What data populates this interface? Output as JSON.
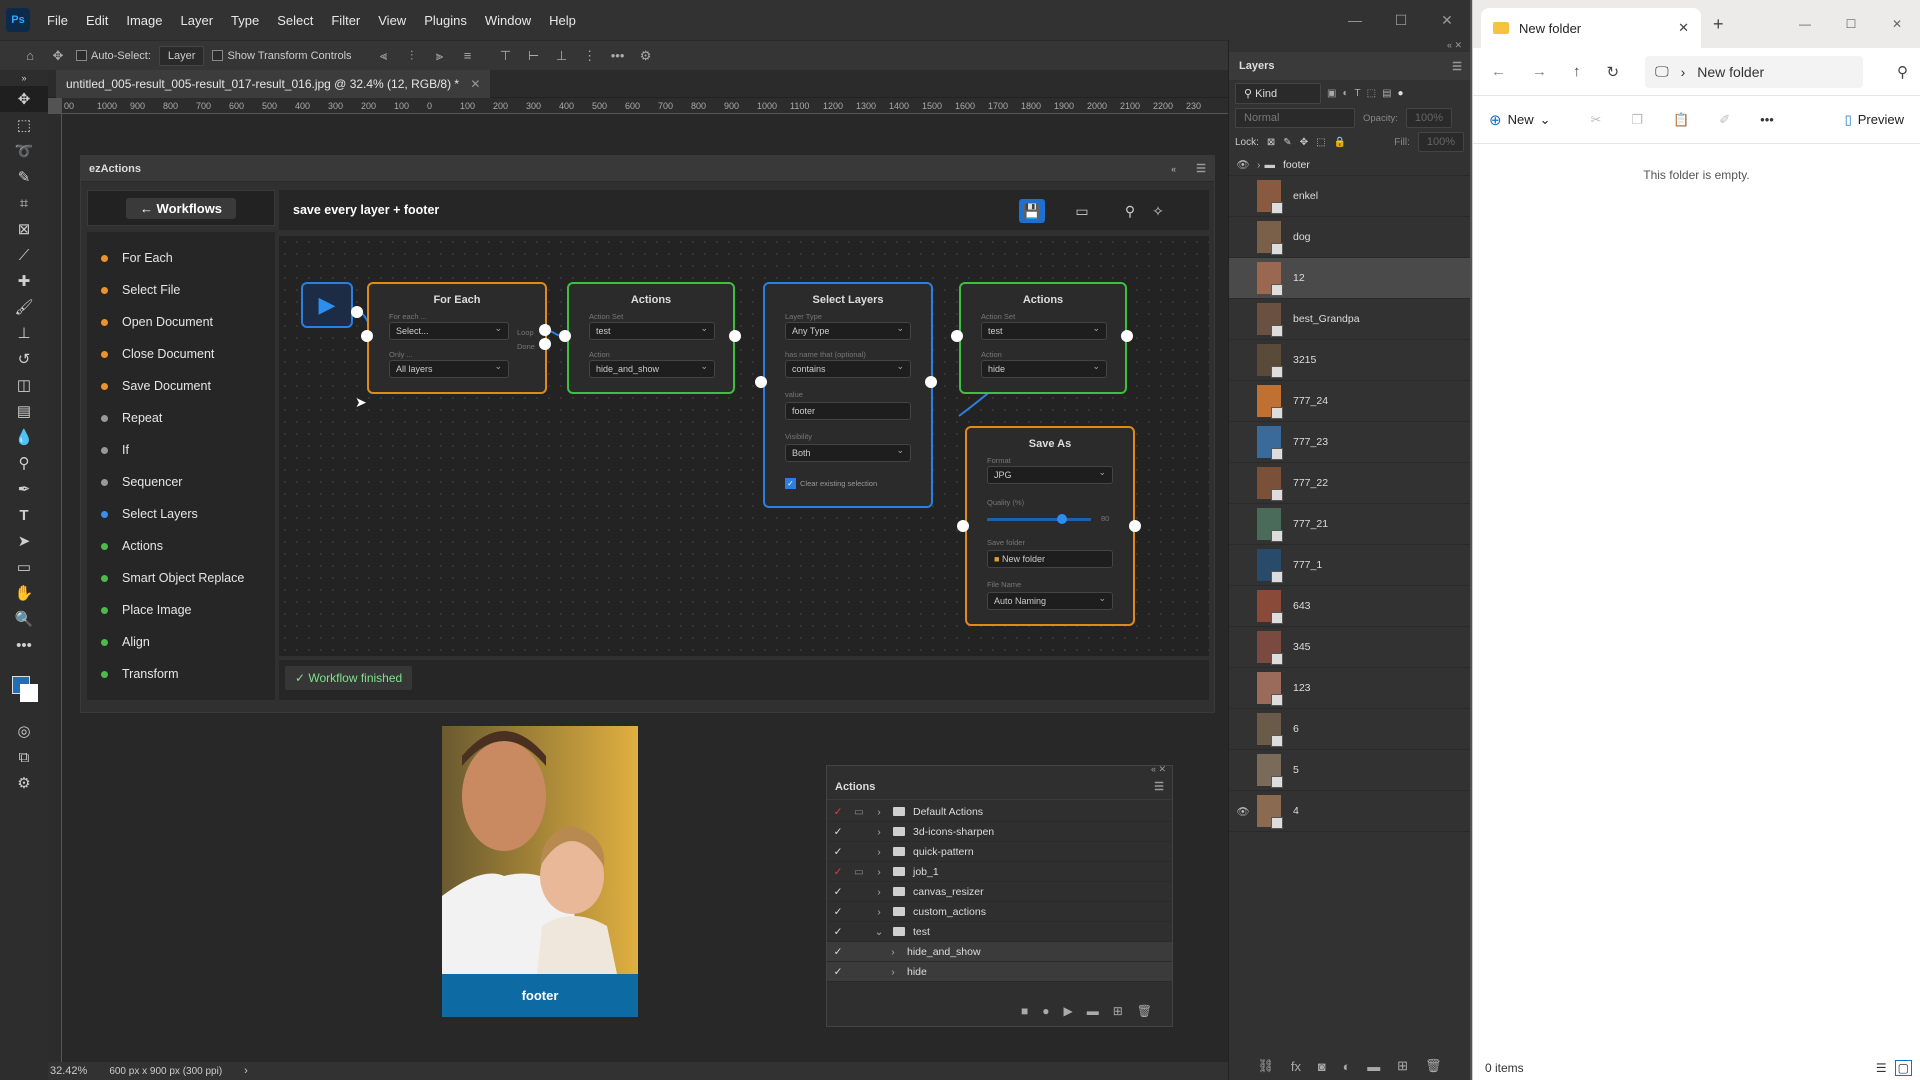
{
  "menu": [
    "File",
    "Edit",
    "Image",
    "Layer",
    "Type",
    "Select",
    "Filter",
    "View",
    "Plugins",
    "Window",
    "Help"
  ],
  "app_logo": "Ps",
  "options": {
    "auto_select": "Auto-Select:",
    "layer": "Layer",
    "transform": "Show Transform Controls"
  },
  "doc_tab": "untitled_005-result_005-result_017-result_016.jpg @ 32.4% (12, RGB/8) *",
  "ruler_ticks": [
    "00",
    "1000",
    "900",
    "800",
    "700",
    "600",
    "500",
    "400",
    "300",
    "200",
    "100",
    "0",
    "100",
    "200",
    "300",
    "400",
    "500",
    "600",
    "700",
    "800",
    "900",
    "1000",
    "1100",
    "1200",
    "1300",
    "1400",
    "1500",
    "1600",
    "1700",
    "1800",
    "1900",
    "2000",
    "2100",
    "2200",
    "230"
  ],
  "status": {
    "zoom": "32.42%",
    "doc": "600 px x 900 px (300 ppi)"
  },
  "ez": {
    "panel_title": "ezActions",
    "workflows_btn": "← Workflows",
    "workflow_title": "save every layer + footer",
    "status": "✓  Workflow finished",
    "list": [
      {
        "label": "For Each",
        "color": "#f0922b"
      },
      {
        "label": "Select File",
        "color": "#f0922b"
      },
      {
        "label": "Open Document",
        "color": "#f0922b"
      },
      {
        "label": "Close Document",
        "color": "#f0922b"
      },
      {
        "label": "Save Document",
        "color": "#f0922b"
      },
      {
        "label": "Repeat",
        "color": "#999999"
      },
      {
        "label": "If",
        "color": "#999999"
      },
      {
        "label": "Sequencer",
        "color": "#999999"
      },
      {
        "label": "Select Layers",
        "color": "#3a8ef0"
      },
      {
        "label": "Actions",
        "color": "#4cbb4c"
      },
      {
        "label": "Smart Object Replace",
        "color": "#4cbb4c"
      },
      {
        "label": "Place Image",
        "color": "#4cbb4c"
      },
      {
        "label": "Align",
        "color": "#4cbb4c"
      },
      {
        "label": "Transform",
        "color": "#4cbb4c"
      }
    ],
    "nodes": {
      "foreach": {
        "title": "For Each",
        "l1": "For each ...",
        "v1": "Select...",
        "l2": "Only ...",
        "v2": "All layers",
        "loop": "Loop",
        "done": "Done"
      },
      "actions1": {
        "title": "Actions",
        "l1": "Action Set",
        "v1": "test",
        "l2": "Action",
        "v2": "hide_and_show"
      },
      "select": {
        "title": "Select Layers",
        "l1": "Layer Type",
        "v1": "Any Type",
        "l2": "has name that (optional)",
        "v2": "contains",
        "l3": "value",
        "v3": "footer",
        "l4": "Visibility",
        "v4": "Both",
        "chk": "Clear existing selection"
      },
      "actions2": {
        "title": "Actions",
        "l1": "Action Set",
        "v1": "test",
        "l2": "Action",
        "v2": "hide"
      },
      "saveas": {
        "title": "Save As",
        "l1": "Format",
        "v1": "JPG",
        "l2": "Quality (%)",
        "v2": "80",
        "l3": "Save folder",
        "v3": "New folder",
        "l4": "File Name",
        "v4": "Auto Naming"
      }
    }
  },
  "thumb_footer": "footer",
  "actions_panel": {
    "title": "Actions",
    "rows": [
      {
        "name": "Default Actions",
        "red": true,
        "dlg": true,
        "open": false,
        "sub": false
      },
      {
        "name": "3d-icons-sharpen",
        "red": false,
        "dlg": false,
        "open": false,
        "sub": false
      },
      {
        "name": "quick-pattern",
        "red": false,
        "dlg": false,
        "open": false,
        "sub": false
      },
      {
        "name": "job_1",
        "red": true,
        "dlg": true,
        "open": false,
        "sub": false
      },
      {
        "name": "canvas_resizer",
        "red": false,
        "dlg": false,
        "open": false,
        "sub": false
      },
      {
        "name": "custom_actions",
        "red": false,
        "dlg": false,
        "open": false,
        "sub": false
      },
      {
        "name": "test",
        "red": false,
        "dlg": false,
        "open": true,
        "sub": false
      },
      {
        "name": "hide_and_show",
        "red": false,
        "dlg": false,
        "open": false,
        "sub": true
      },
      {
        "name": "hide",
        "red": false,
        "dlg": false,
        "open": false,
        "sub": true
      }
    ]
  },
  "layers_panel": {
    "title": "Layers",
    "kind": "Kind",
    "blend": "Normal",
    "opacity_label": "Opacity:",
    "opacity": "100%",
    "lock": "Lock:",
    "fill_label": "Fill:",
    "fill": "100%",
    "group": "footer",
    "layers": [
      {
        "name": "enkel",
        "vis": false,
        "sel": false
      },
      {
        "name": "dog",
        "vis": false,
        "sel": false
      },
      {
        "name": "12",
        "vis": false,
        "sel": true
      },
      {
        "name": "best_Grandpa",
        "vis": false,
        "sel": false
      },
      {
        "name": "3215",
        "vis": false,
        "sel": false
      },
      {
        "name": "777_24",
        "vis": false,
        "sel": false
      },
      {
        "name": "777_23",
        "vis": false,
        "sel": false
      },
      {
        "name": "777_22",
        "vis": false,
        "sel": false
      },
      {
        "name": "777_21",
        "vis": false,
        "sel": false
      },
      {
        "name": "777_1",
        "vis": false,
        "sel": false
      },
      {
        "name": "643",
        "vis": false,
        "sel": false
      },
      {
        "name": "345",
        "vis": false,
        "sel": false
      },
      {
        "name": "123",
        "vis": false,
        "sel": false
      },
      {
        "name": "6",
        "vis": false,
        "sel": false
      },
      {
        "name": "5",
        "vis": false,
        "sel": false
      },
      {
        "name": "4",
        "vis": true,
        "sel": false
      }
    ]
  },
  "explorer": {
    "tab": "New folder",
    "address": "New folder",
    "new_btn": "New",
    "preview": "Preview",
    "empty": "This folder is empty.",
    "status": "0 items"
  }
}
